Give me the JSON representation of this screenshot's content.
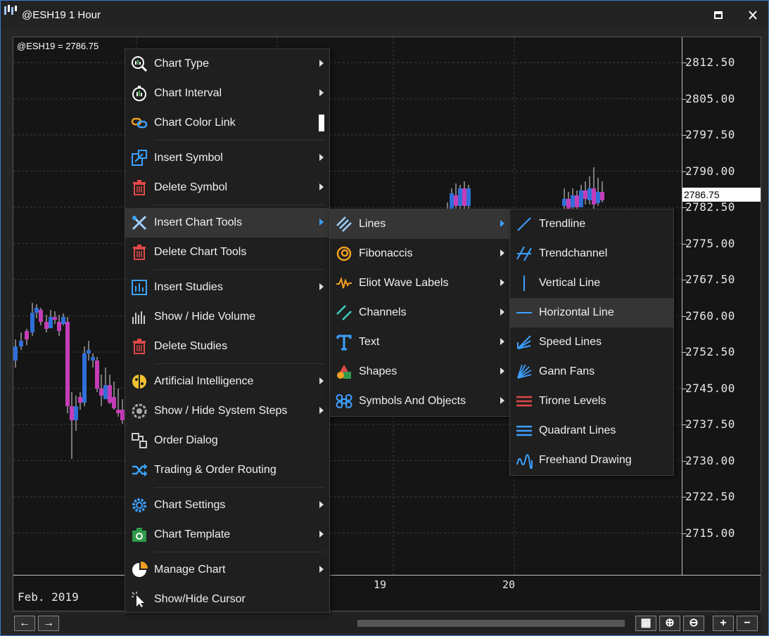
{
  "window": {
    "title": "@ESH19 1 Hour"
  },
  "chart": {
    "symbol_label": "@ESH19 = 2786.75",
    "current_price": "2786.75",
    "price_axis": [
      "2812.50",
      "2805.00",
      "2797.50",
      "2790.00",
      "2782.50",
      "2775.00",
      "2767.50",
      "2760.00",
      "2752.50",
      "2745.00",
      "2737.50",
      "2730.00",
      "2722.50",
      "2715.00"
    ],
    "time_axis": [
      "19",
      "20"
    ],
    "date_label": "Feb. 2019"
  },
  "context_menu": {
    "items": [
      {
        "label": "Chart Type",
        "icon": "chart-type-icon",
        "submenu": true
      },
      {
        "label": "Chart Interval",
        "icon": "stopwatch-icon",
        "submenu": true
      },
      {
        "label": "Chart Color Link",
        "icon": "link-icon",
        "submenu": false
      },
      {
        "label": "Insert Symbol",
        "icon": "insert-symbol-icon",
        "submenu": true
      },
      {
        "label": "Delete Symbol",
        "icon": "trash-icon",
        "submenu": true
      },
      {
        "label": "Insert Chart Tools",
        "icon": "chart-tools-icon",
        "submenu": true
      },
      {
        "label": "Delete Chart Tools",
        "icon": "trash-icon",
        "submenu": false
      },
      {
        "label": "Insert Studies",
        "icon": "studies-icon",
        "submenu": true
      },
      {
        "label": "Show / Hide Volume",
        "icon": "volume-icon",
        "submenu": false
      },
      {
        "label": "Delete Studies",
        "icon": "trash-icon",
        "submenu": false
      },
      {
        "label": "Artificial Intelligence",
        "icon": "brain-icon",
        "submenu": true
      },
      {
        "label": "Show / Hide System Steps",
        "icon": "system-steps-icon",
        "submenu": true
      },
      {
        "label": "Order Dialog",
        "icon": "order-dialog-icon",
        "submenu": false
      },
      {
        "label": "Trading & Order Routing",
        "icon": "routing-icon",
        "submenu": false
      },
      {
        "label": "Chart Settings",
        "icon": "gear-icon",
        "submenu": true
      },
      {
        "label": "Chart Template",
        "icon": "template-icon",
        "submenu": true
      },
      {
        "label": "Manage Chart",
        "icon": "manage-chart-icon",
        "submenu": true
      },
      {
        "label": "Show/Hide Cursor",
        "icon": "cursor-icon",
        "submenu": false
      }
    ]
  },
  "tools_menu": {
    "items": [
      {
        "label": "Lines",
        "icon": "lines-icon"
      },
      {
        "label": "Fibonaccis",
        "icon": "fibonacci-icon"
      },
      {
        "label": "Eliot Wave Labels",
        "icon": "wave-icon"
      },
      {
        "label": "Channels",
        "icon": "channels-icon"
      },
      {
        "label": "Text",
        "icon": "text-icon"
      },
      {
        "label": "Shapes",
        "icon": "shapes-icon"
      },
      {
        "label": "Symbols And Objects",
        "icon": "symbols-icon"
      }
    ]
  },
  "lines_menu": {
    "items": [
      {
        "label": "Trendline",
        "icon": "trendline-icon"
      },
      {
        "label": "Trendchannel",
        "icon": "trendchannel-icon"
      },
      {
        "label": "Vertical Line",
        "icon": "vertical-line-icon"
      },
      {
        "label": "Horizontal Line",
        "icon": "horizontal-line-icon"
      },
      {
        "label": "Speed Lines",
        "icon": "speed-lines-icon"
      },
      {
        "label": "Gann Fans",
        "icon": "gann-fans-icon"
      },
      {
        "label": "Tirone Levels",
        "icon": "tirone-levels-icon"
      },
      {
        "label": "Quadrant Lines",
        "icon": "quadrant-lines-icon"
      },
      {
        "label": "Freehand Drawing",
        "icon": "freehand-icon"
      }
    ]
  },
  "colors": {
    "up": "#2f6fd8",
    "down": "#c43db8",
    "accent": "#3ba1ff"
  }
}
